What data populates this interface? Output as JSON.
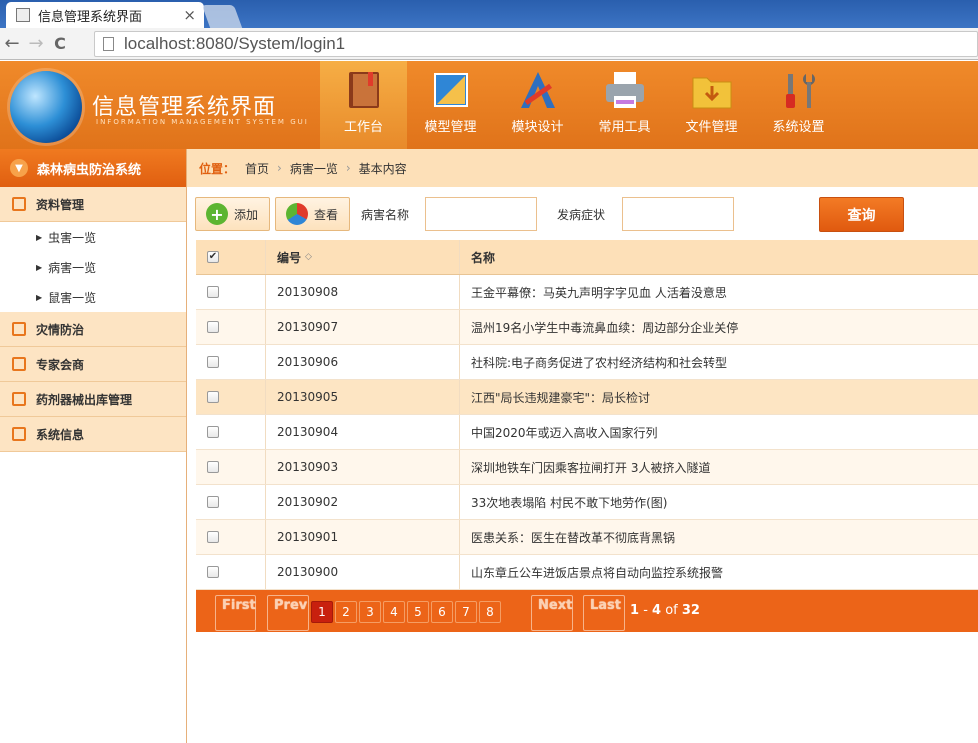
{
  "browser": {
    "tab_title": "信息管理系统界面",
    "tab_close": "×",
    "url": "localhost:8080/System/login1",
    "back": "←",
    "forward": "→",
    "reload": "C"
  },
  "header": {
    "logo_title": "信息管理系统界面",
    "logo_subtitle": "INFORMATION MANAGEMENT SYSTEM GUI",
    "nav": [
      {
        "label": "工作台",
        "icon": "book-icon",
        "active": true
      },
      {
        "label": "模型管理",
        "icon": "ruler-icon",
        "active": false
      },
      {
        "label": "模块设计",
        "icon": "design-tools-icon",
        "active": false
      },
      {
        "label": "常用工具",
        "icon": "printer-icon",
        "active": false
      },
      {
        "label": "文件管理",
        "icon": "folder-icon",
        "active": false
      },
      {
        "label": "系统设置",
        "icon": "wrench-screwdriver-icon",
        "active": false
      }
    ]
  },
  "sidebar": {
    "title": "森林病虫防治系统",
    "groups": [
      {
        "label": "资料管理",
        "icon": "list-icon",
        "items": [
          "虫害一览",
          "病害一览",
          "鼠害一览"
        ]
      },
      {
        "label": "灾情防治",
        "icon": "chat-icon",
        "items": []
      },
      {
        "label": "专家会商",
        "icon": "edit-icon",
        "items": []
      },
      {
        "label": "药剂器械出库管理",
        "icon": "calendar-icon",
        "items": []
      },
      {
        "label": "系统信息",
        "icon": "calendar-icon",
        "items": []
      }
    ]
  },
  "breadcrumb": {
    "label": "位置：",
    "items": [
      "首页",
      "病害一览",
      "基本内容"
    ],
    "separator": "›"
  },
  "toolbar": {
    "add_label": "添加",
    "view_label": "查看",
    "disease_name_label": "病害名称",
    "symptom_label": "发病症状",
    "query_label": "查询",
    "disease_name_value": "",
    "symptom_value": ""
  },
  "table": {
    "headers": {
      "id": "编号",
      "sort_icon": "◇",
      "name": "名称"
    },
    "header_checked": true,
    "rows": [
      {
        "id": "20130908",
        "name": "王金平幕僚：马英九声明字字见血 人活着没意思"
      },
      {
        "id": "20130907",
        "name": "温州19名小学生中毒流鼻血续：周边部分企业关停"
      },
      {
        "id": "20130906",
        "name": "社科院:电子商务促进了农村经济结构和社会转型"
      },
      {
        "id": "20130905",
        "name": "江西\"局长违规建豪宅\"：局长检讨"
      },
      {
        "id": "20130904",
        "name": "中国2020年或迈入高收入国家行列"
      },
      {
        "id": "20130903",
        "name": "深圳地铁车门因乘客拉闸打开 3人被挤入隧道"
      },
      {
        "id": "20130902",
        "name": "33次地表塌陷 村民不敢下地劳作(图)"
      },
      {
        "id": "20130901",
        "name": "医患关系：医生在替改革不彻底背黑锅"
      },
      {
        "id": "20130900",
        "name": "山东章丘公车进饭店景点将自动向监控系统报警"
      }
    ]
  },
  "pager": {
    "first": "First",
    "prev": "Prev",
    "next": "Next",
    "last": "Last",
    "pages": [
      "1",
      "2",
      "3",
      "4",
      "5",
      "6",
      "7",
      "8"
    ],
    "current": "1",
    "range_start": "1",
    "range_dash": "-",
    "range_end": "4",
    "of": "of",
    "total": "32"
  },
  "colors": {
    "brand_orange": "#e8761d",
    "current_page": "#c8200e"
  }
}
